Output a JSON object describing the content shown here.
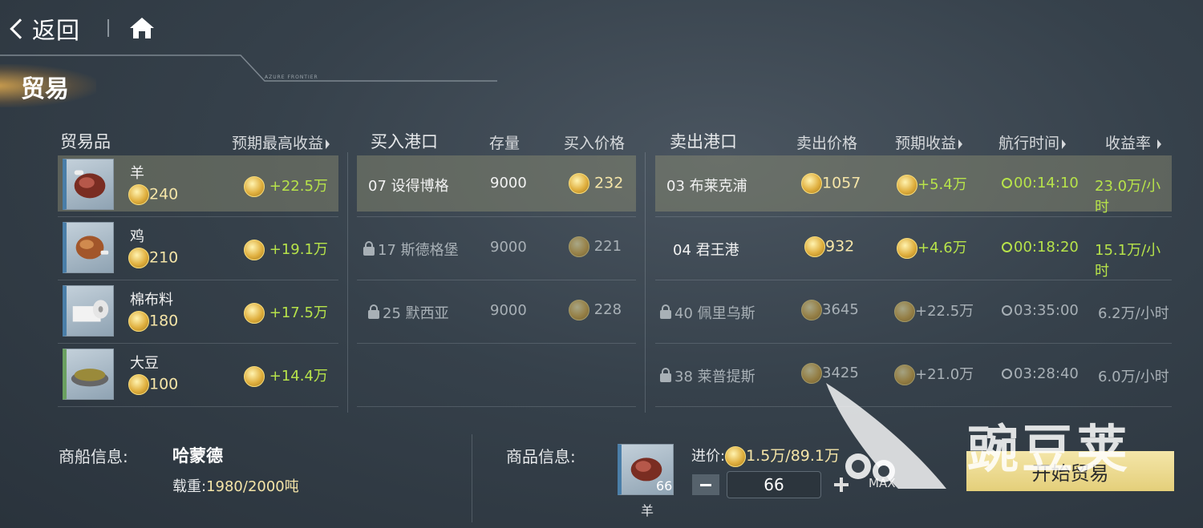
{
  "nav": {
    "back_label": "返回"
  },
  "page": {
    "title": "贸易",
    "subtitle_small": "AZURE FRONTIER"
  },
  "goods_header": {
    "name": "贸易品",
    "max_profit": "预期最高收益"
  },
  "goods": [
    {
      "name": "羊",
      "price": "240",
      "profit": "+22.5万",
      "thumb_icon": "mutton-icon"
    },
    {
      "name": "鸡",
      "price": "210",
      "profit": "+19.1万",
      "thumb_icon": "roast-chicken-icon"
    },
    {
      "name": "棉布料",
      "price": "180",
      "profit": "+17.5万",
      "thumb_icon": "cotton-cloth-icon"
    },
    {
      "name": "大豆",
      "price": "100",
      "profit": "+14.4万",
      "thumb_icon": "soybean-icon"
    }
  ],
  "buy_header": {
    "port": "买入港口",
    "stock": "存量",
    "price": "买入价格"
  },
  "buy_ports": [
    {
      "port": "07 设得博格",
      "stock": "9000",
      "price": "232",
      "locked": false
    },
    {
      "port": "17 斯德格堡",
      "stock": "9000",
      "price": "221",
      "locked": true
    },
    {
      "port": "25 默西亚",
      "stock": "9000",
      "price": "228",
      "locked": true
    }
  ],
  "sell_header": {
    "port": "卖出港口",
    "price": "卖出价格",
    "profit": "预期收益",
    "time": "航行时间",
    "rate": "收益率"
  },
  "sell_ports": [
    {
      "port": "03 布莱克浦",
      "price": "1057",
      "profit": "+5.4万",
      "time": "00:14:10",
      "rate": "23.0万/小时",
      "locked": false
    },
    {
      "port": "04 君王港",
      "price": "932",
      "profit": "+4.6万",
      "time": "00:18:20",
      "rate": "15.1万/小时",
      "locked": false
    },
    {
      "port": "40 佩里乌斯",
      "price": "3645",
      "profit": "+22.5万",
      "time": "03:35:00",
      "rate": "6.2万/小时",
      "locked": true
    },
    {
      "port": "38 莱普提斯",
      "price": "3425",
      "profit": "+21.0万",
      "time": "03:28:40",
      "rate": "6.0万/小时",
      "locked": true
    }
  ],
  "ship": {
    "label": "商船信息:",
    "name": "哈蒙德",
    "load_label": "载重:",
    "load_value": "1980/2000吨"
  },
  "goods_info": {
    "label": "商品信息:",
    "item_name": "羊",
    "item_qty": "66",
    "cost_label": "进价:",
    "cost_value": "1.5万/89.1万",
    "quantity": "66",
    "max_label": "MAX"
  },
  "action": {
    "start_label": "开始贸易"
  },
  "watermark": {
    "text": "豌豆荚"
  },
  "colors": {
    "gold": "#f5e5a8",
    "profit_green": "#b7e34a",
    "button": "#eedb90",
    "selected_row": "#8c8b6e"
  }
}
